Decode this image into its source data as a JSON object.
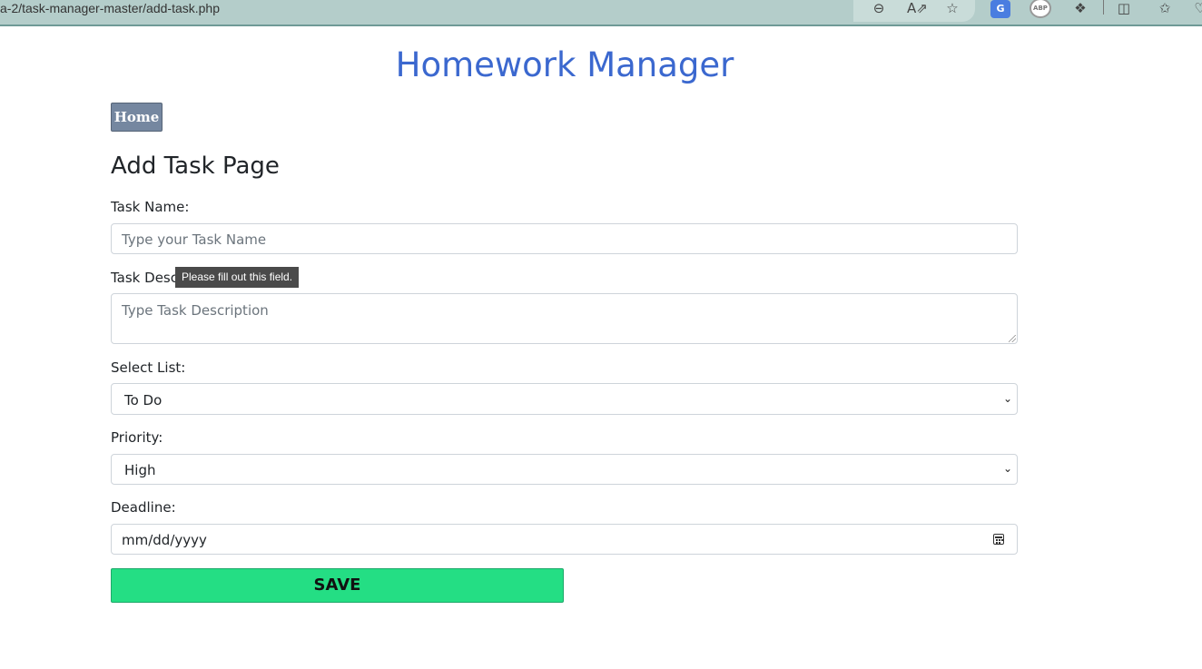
{
  "browser": {
    "url": "a-2/task-manager-master/add-task.php",
    "icons": [
      "zoom-out-icon",
      "read-aloud-icon",
      "favorite-star-icon",
      "translate-extension-icon",
      "adblock-extension-icon",
      "extensions-puzzle-icon",
      "split-screen-icon",
      "favorites-list-icon"
    ],
    "ext_translate_glyph": "G",
    "ext_abp_text": "ABP"
  },
  "page": {
    "title": "Homework Manager",
    "home_button": "Home",
    "heading": "Add Task Page"
  },
  "form": {
    "task_name_label": "Task Name:",
    "task_name_placeholder": "Type your Task Name",
    "task_description_label": "Task Description:",
    "task_description_visible_label": "Task Desc",
    "task_description_placeholder": "Type Task Description",
    "list_label": "Select List:",
    "list_value": "To Do",
    "priority_label": "Priority:",
    "priority_value": "High",
    "deadline_label": "Deadline:",
    "deadline_placeholder": "mm/dd/yyyy",
    "save_button": "SAVE"
  },
  "tooltip": {
    "text": "Please fill out this field."
  },
  "colors": {
    "title": "#3b68cf",
    "home_button_bg": "#7587a0",
    "save_button_bg": "#24de84",
    "browser_bar": "#b4cdca"
  }
}
